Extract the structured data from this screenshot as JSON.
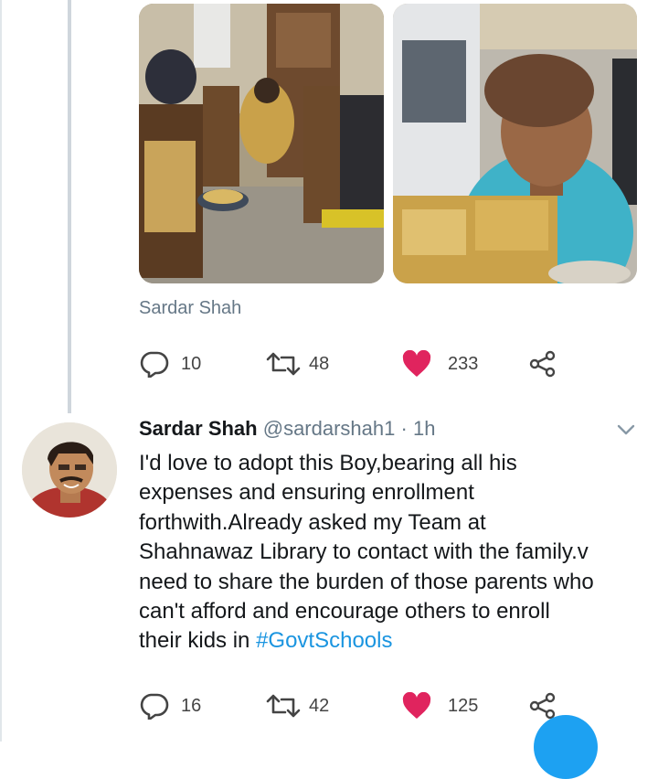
{
  "first_tweet": {
    "caption": "Sardar Shah",
    "actions": {
      "replies": "10",
      "retweets": "48",
      "likes": "233"
    }
  },
  "second_tweet": {
    "name": "Sardar Shah",
    "handle": "@sardarshah1",
    "separator": "·",
    "time": "1h",
    "body_lines": [
      "I'd love to adopt this Boy,bearing all his",
      "expenses and ensuring enrollment",
      "forthwith.Already asked my Team at",
      "Shahnawaz Library to contact with the family.v",
      "need to share the burden of those parents who",
      "can't afford and encourage others to enroll",
      "their kids in "
    ],
    "hashtag": "#GovtSchools",
    "actions": {
      "replies": "16",
      "retweets": "42",
      "likes": "125"
    }
  },
  "colors": {
    "like_red": "#e0245e",
    "link_blue": "#1b95e0",
    "muted_gray": "#657786",
    "fab_blue": "#1da1f2"
  },
  "icons": [
    "reply-icon",
    "retweet-icon",
    "heart-icon",
    "share-icon",
    "chevron-down-icon",
    "compose-fab-icon"
  ]
}
